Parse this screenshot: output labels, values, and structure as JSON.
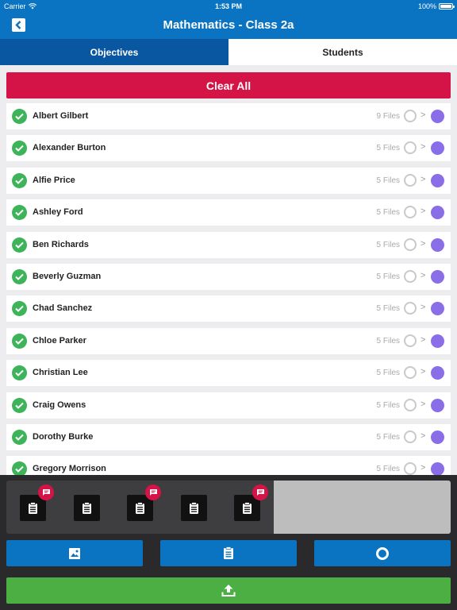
{
  "status_bar": {
    "carrier": "Carrier",
    "time": "1:53 PM",
    "battery": "100%",
    "battery_level": 1.0
  },
  "nav": {
    "title": "Mathematics - Class 2a",
    "back_icon": "back-chevron-icon"
  },
  "tabs": [
    {
      "label": "Objectives",
      "active": true
    },
    {
      "label": "Students",
      "active": false
    }
  ],
  "clear_all": {
    "label": "Clear All"
  },
  "students": [
    {
      "name": "Albert Gilbert",
      "files": "9 Files"
    },
    {
      "name": "Alexander Burton",
      "files": "5 Files"
    },
    {
      "name": "Alfie Price",
      "files": "5 Files"
    },
    {
      "name": "Ashley Ford",
      "files": "5 Files"
    },
    {
      "name": "Ben Richards",
      "files": "5 Files"
    },
    {
      "name": "Beverly Guzman",
      "files": "5 Files"
    },
    {
      "name": "Chad Sanchez",
      "files": "5 Files"
    },
    {
      "name": "Chloe Parker",
      "files": "5 Files"
    },
    {
      "name": "Christian Lee",
      "files": "5 Files"
    },
    {
      "name": "Craig Owens",
      "files": "5 Files"
    },
    {
      "name": "Dorothy Burke",
      "files": "5 Files"
    },
    {
      "name": "Gregory Morrison",
      "files": "5 Files"
    }
  ],
  "row_arrow": ">",
  "tray": {
    "items": [
      {
        "icon": "clipboard-icon",
        "has_comment": true
      },
      {
        "icon": "clipboard-icon",
        "has_comment": false
      },
      {
        "icon": "clipboard-icon",
        "has_comment": true
      },
      {
        "icon": "clipboard-icon",
        "has_comment": false
      },
      {
        "icon": "clipboard-icon",
        "has_comment": true
      }
    ]
  },
  "actions": [
    {
      "icon": "image-icon"
    },
    {
      "icon": "clipboard-icon"
    },
    {
      "icon": "circle-icon"
    }
  ],
  "upload": {
    "icon": "upload-icon"
  },
  "colors": {
    "primary": "#0a74c2",
    "tab_active": "#0957a0",
    "danger": "#d41346",
    "success": "#4caf44",
    "check": "#3db35a",
    "status_dot": "#8a6ee8"
  }
}
